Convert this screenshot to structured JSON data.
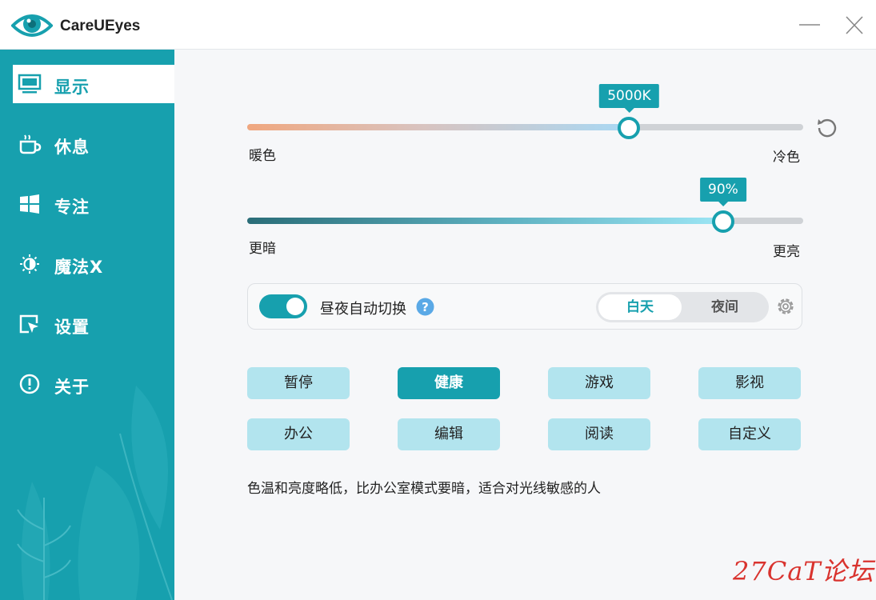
{
  "app": {
    "title": "CareUEyes"
  },
  "sidebar": {
    "items": [
      {
        "label": "显示",
        "icon": "monitor-icon",
        "active": true
      },
      {
        "label": "休息",
        "icon": "coffee-cup-icon"
      },
      {
        "label": "专注",
        "icon": "windows-grid-icon"
      },
      {
        "label": "魔法X",
        "icon": "sun-moon-icon"
      },
      {
        "label": "设置",
        "icon": "cursor-window-icon"
      },
      {
        "label": "关于",
        "icon": "info-exclamation-icon"
      }
    ]
  },
  "color_temp": {
    "value_label": "5000K",
    "fraction": 0.687,
    "min_label": "暖色",
    "max_label": "冷色"
  },
  "brightness": {
    "value_label": "90%",
    "fraction": 0.856,
    "min_label": "更暗",
    "max_label": "更亮"
  },
  "auto_switch": {
    "label": "昼夜自动切换",
    "enabled": true,
    "day_label": "白天",
    "night_label": "夜间",
    "selected": "day"
  },
  "modes": [
    {
      "label": "暂停"
    },
    {
      "label": "健康",
      "active": true
    },
    {
      "label": "游戏"
    },
    {
      "label": "影视"
    },
    {
      "label": "办公"
    },
    {
      "label": "编辑"
    },
    {
      "label": "阅读"
    },
    {
      "label": "自定义"
    }
  ],
  "description": "色温和亮度略低，比办公室模式要暗，适合对光线敏感的人",
  "watermark": "27CaT论坛",
  "colors": {
    "accent": "#17a0ae",
    "sidebar": "#17a0ae",
    "mode_button": "#b2e4ee",
    "warm": "#f0a77f",
    "cool": "#a8d8f4"
  }
}
